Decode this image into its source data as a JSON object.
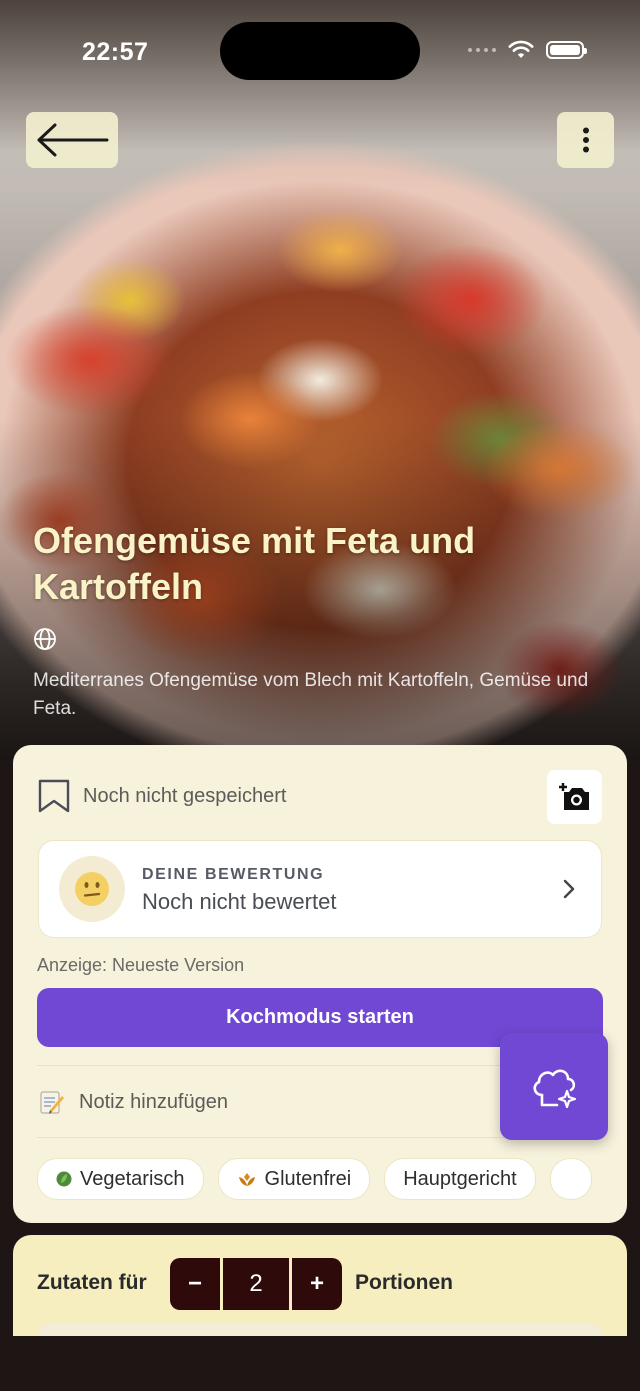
{
  "status_bar": {
    "time": "22:57"
  },
  "recipe": {
    "title": "Ofengemüse mit Feta und Kartoffeln",
    "description": "Mediterranes Ofengemüse vom Blech mit Kartoffeln, Gemüse und Feta.",
    "source_icon": "globe-icon"
  },
  "save": {
    "label": "Noch nicht gespeichert"
  },
  "rating": {
    "label": "DEINE BEWERTUNG",
    "value": "Noch nicht bewertet"
  },
  "version_text": "Anzeige: Neueste Version",
  "cook_button": "Kochmodus starten",
  "note": {
    "label": "Notiz hinzufügen"
  },
  "tags": [
    {
      "label": "Vegetarisch",
      "icon": "leaf-icon"
    },
    {
      "label": "Glutenfrei",
      "icon": "wheat-icon"
    },
    {
      "label": "Hauptgericht",
      "icon": ""
    }
  ],
  "ingredients": {
    "prefix": "Zutaten für",
    "servings": "2",
    "suffix": "Portionen",
    "minus": "−",
    "plus": "+"
  },
  "colors": {
    "accent": "#7048d4",
    "card": "#f7f2dc",
    "stepper": "#2f0a0a",
    "title": "#fbf3c8"
  }
}
